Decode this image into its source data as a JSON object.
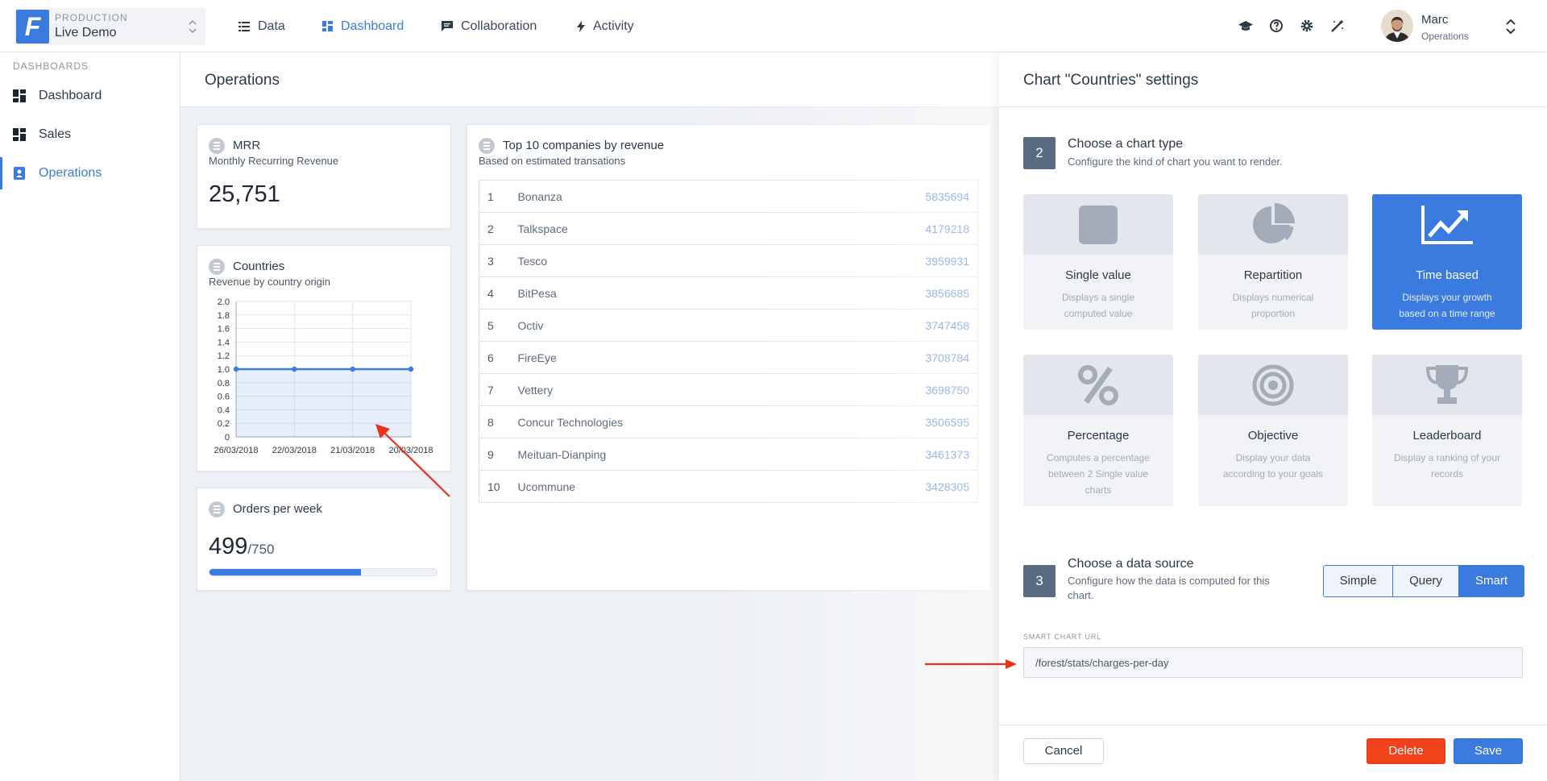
{
  "env": {
    "logo": "F",
    "label": "PRODUCTION",
    "name": "Live Demo"
  },
  "nav": [
    {
      "label": "Data",
      "icon": "list-icon"
    },
    {
      "label": "Dashboard",
      "icon": "dashboard-icon",
      "active": true
    },
    {
      "label": "Collaboration",
      "icon": "chat-icon"
    },
    {
      "label": "Activity",
      "icon": "lightning-icon"
    }
  ],
  "toolbar_icons": [
    "graduation-cap-icon",
    "help-icon",
    "gear-icon",
    "wand-icon"
  ],
  "user": {
    "name": "Marc",
    "role": "Operations"
  },
  "sidebar": {
    "heading": "DASHBOARDS",
    "items": [
      {
        "label": "Dashboard"
      },
      {
        "label": "Sales"
      },
      {
        "label": "Operations",
        "active": true
      }
    ]
  },
  "main": {
    "title": "Operations",
    "mrr": {
      "title": "MRR",
      "subtitle": "Monthly Recurring Revenue",
      "value": "25,751"
    },
    "countries": {
      "title": "Countries",
      "subtitle": "Revenue by country origin"
    },
    "orders": {
      "title": "Orders per week",
      "value": "499",
      "goal": "/750",
      "progress": 0.665
    },
    "top10": {
      "title": "Top 10 companies by revenue",
      "subtitle": "Based on estimated transations",
      "rows": [
        {
          "rank": "1",
          "name": "Bonanza",
          "value": "5835694"
        },
        {
          "rank": "2",
          "name": "Talkspace",
          "value": "4179218"
        },
        {
          "rank": "3",
          "name": "Tesco",
          "value": "3959931"
        },
        {
          "rank": "4",
          "name": "BitPesa",
          "value": "3856685"
        },
        {
          "rank": "5",
          "name": "Octiv",
          "value": "3747458"
        },
        {
          "rank": "6",
          "name": "FireEye",
          "value": "3708784"
        },
        {
          "rank": "7",
          "name": "Vettery",
          "value": "3698750"
        },
        {
          "rank": "8",
          "name": "Concur Technologies",
          "value": "3506595"
        },
        {
          "rank": "9",
          "name": "Meituan-Dianping",
          "value": "3461373"
        },
        {
          "rank": "10",
          "name": "Ucommune",
          "value": "3428305"
        }
      ]
    }
  },
  "chart_data": {
    "type": "area",
    "title": "Countries",
    "subtitle": "Revenue by country origin",
    "categories": [
      "26/03/2018",
      "22/03/2018",
      "21/03/2018",
      "20/03/2018"
    ],
    "series": [
      {
        "values": [
          1.0,
          1.0,
          1.0,
          1.0
        ]
      }
    ],
    "yticks": [
      "2.0",
      "1.8",
      "1.6",
      "1.4",
      "1.2",
      "1.0",
      "0.8",
      "0.6",
      "0.4",
      "0.2",
      "0"
    ],
    "ylim": [
      0,
      2.0
    ],
    "grid": true,
    "color": "#3b7be0"
  },
  "panel": {
    "title": "Chart \"Countries\" settings",
    "step2": {
      "number": "2",
      "title": "Choose a chart type",
      "desc": "Configure the kind of chart you want to render.",
      "types": [
        {
          "name": "Single value",
          "desc": "Displays a single computed value",
          "icon": "square-icon"
        },
        {
          "name": "Repartition",
          "desc": "Displays numerical proportion",
          "icon": "pie-icon"
        },
        {
          "name": "Time based",
          "desc": "Displays your growth based on a time range",
          "icon": "line-chart-icon",
          "selected": true
        },
        {
          "name": "Percentage",
          "desc": "Computes a percentage between 2 Single value charts",
          "icon": "percent-icon"
        },
        {
          "name": "Objective",
          "desc": "Display your data according to your goals",
          "icon": "target-icon"
        },
        {
          "name": "Leaderboard",
          "desc": "Display a ranking of your records",
          "icon": "trophy-icon"
        }
      ]
    },
    "step3": {
      "number": "3",
      "title": "Choose a data source",
      "desc": "Configure how the data is computed for this chart.",
      "options": [
        "Simple",
        "Query",
        "Smart"
      ],
      "selected": "Smart"
    },
    "smart_url": {
      "label": "SMART CHART URL",
      "value": "/forest/stats/charges-per-day"
    },
    "buttons": {
      "cancel": "Cancel",
      "delete": "Delete",
      "save": "Save"
    }
  },
  "colors": {
    "accent": "#3b7be0",
    "danger": "#f0431c",
    "annotation": "#e8321c"
  }
}
